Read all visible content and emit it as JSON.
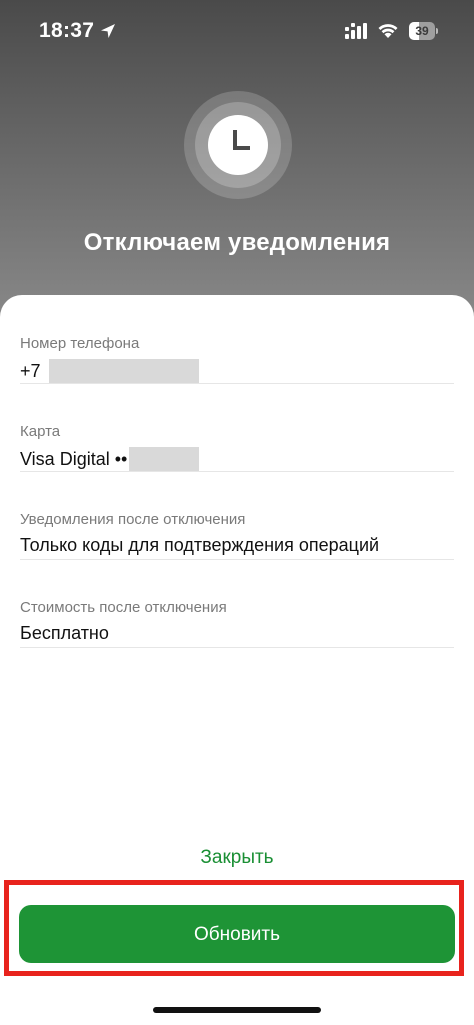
{
  "status_bar": {
    "time": "18:37",
    "battery_level": "39",
    "icons": [
      "location-arrow-icon",
      "cellular-signal-icon",
      "wifi-icon",
      "battery-icon"
    ]
  },
  "header": {
    "icon": "clock-icon",
    "title": "Отключаем уведомления",
    "gradient_top": "#4a4a4a",
    "gradient_bottom": "#8a8a8a"
  },
  "details": [
    {
      "label": "Номер телефона",
      "value": "+7 ",
      "redacted": true
    },
    {
      "label": "Карта",
      "value": "Visa Digital ••",
      "redacted": true
    },
    {
      "label": "Уведомления после отключения",
      "value": "Только коды для подтверждения операций",
      "redacted": false
    },
    {
      "label": "Стоимость после отключения",
      "value": "Бесплатно",
      "redacted": false
    }
  ],
  "actions": {
    "close_label": "Закрыть",
    "update_label": "Обновить",
    "accent_color": "#1e9436",
    "highlight_color": "#e8231d"
  }
}
